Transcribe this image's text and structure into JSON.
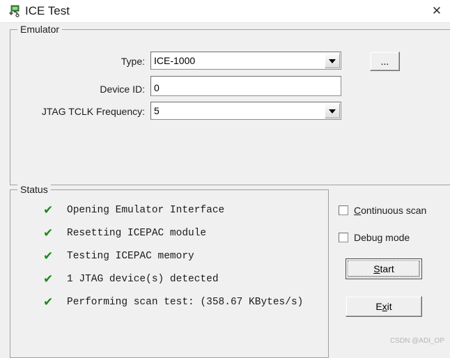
{
  "window": {
    "title": "ICE Test",
    "icon": "ice-app-icon",
    "close_label": "✕"
  },
  "emulator": {
    "group_title": "Emulator",
    "fields": [
      {
        "label": "Type:",
        "value": "ICE-1000",
        "kind": "combobox"
      },
      {
        "label": "Device ID:",
        "value": "0",
        "kind": "textbox"
      },
      {
        "label": "JTAG TCLK Frequency:",
        "value": "5",
        "kind": "combobox"
      }
    ],
    "browse_button": "..."
  },
  "status": {
    "group_title": "Status",
    "check_glyph": "✔",
    "items": [
      "Opening Emulator Interface",
      "Resetting ICEPAC module",
      "Testing ICEPAC memory",
      "1 JTAG device(s) detected",
      "Performing scan test: (358.67 KBytes/s)"
    ]
  },
  "options": {
    "continuous_scan": {
      "accel": "C",
      "rest": "ontinuous scan",
      "checked": false
    },
    "debug_mode": {
      "accel": "D",
      "rest": "ebug mode",
      "checked": false
    }
  },
  "actions": {
    "start": {
      "pre": "",
      "accel": "S",
      "post": "tart"
    },
    "exit": {
      "pre": "E",
      "accel": "x",
      "post": "it"
    }
  },
  "watermark": "CSDN @ADI_OP",
  "colors": {
    "background": "#f0f0f0",
    "titlebar": "#ffffff",
    "check_green": "#1a8a1a",
    "border": "#a0a0a0",
    "text": "#1b1b1b"
  }
}
